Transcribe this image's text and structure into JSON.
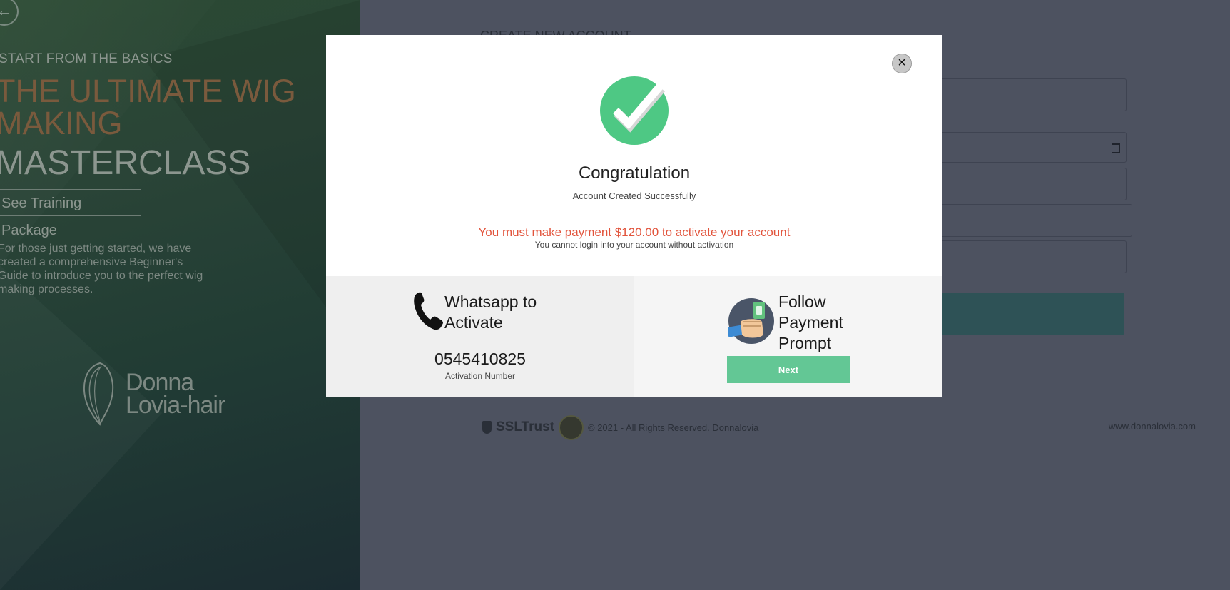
{
  "left_panel": {
    "eyebrow": "START FROM THE BASICS",
    "hero_line1": "THE ULTIMATE WIG",
    "hero_line2": "MAKING",
    "hero_line3": "MASTERCLASS",
    "training_button": "See Training Package",
    "description": "For those just getting started, we have created a comprehensive Beginner's Guide to introduce you to the perfect wig making processes.",
    "logo_line1": "Donna",
    "logo_line2": "Lovia-hair"
  },
  "form": {
    "title": "CREATE NEW ACCOUNT"
  },
  "footer": {
    "ssl_label": "SSLTrust",
    "copyright": "© 2021 -  All Rights Reserved. Donnalovia",
    "website": "www.donnalovia.com"
  },
  "modal": {
    "close_label": "×",
    "title": "Congratulation",
    "subtitle": "Account Created Successfully",
    "payment_warning": "You must make payment $120.00 to activate your account",
    "activation_note": "You cannot login into your account without activation",
    "whatsapp": {
      "label_line1": "Whatsapp to",
      "label_line2": "Activate",
      "number": "0545410825",
      "number_label": "Activation Number"
    },
    "payment": {
      "label_line1": "Follow",
      "label_line2": "Payment",
      "label_line3": "Prompt",
      "next_button": "Next"
    }
  },
  "colors": {
    "success_green": "#4ec884",
    "warning_red": "#e2543c",
    "next_button": "#63c795"
  }
}
